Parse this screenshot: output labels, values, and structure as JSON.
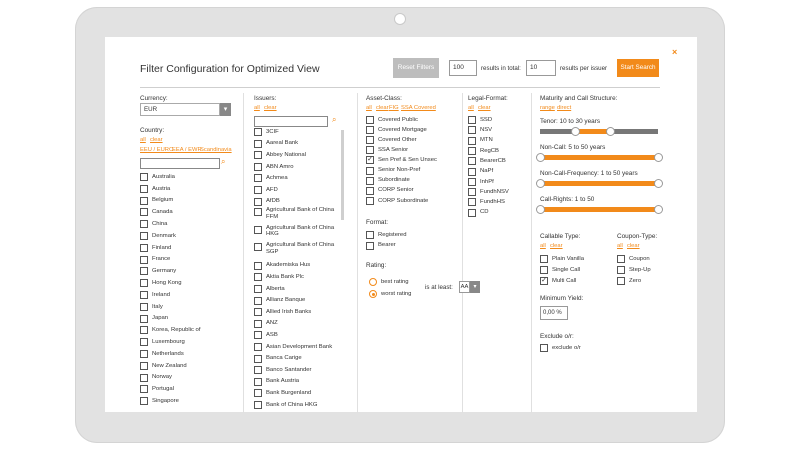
{
  "header": {
    "title": "Filter Configuration for Optimized View",
    "reset_label": "Reset Filters",
    "results_total_value": "100",
    "results_total_label": "results in total:",
    "results_per_issuer_value": "10",
    "results_per_issuer_label": "results per issuer",
    "search_label": "Start Search",
    "close_glyph": "×"
  },
  "currency": {
    "label": "Currency:",
    "value": "EUR"
  },
  "country": {
    "label": "Country:",
    "links": [
      "all",
      "clear"
    ],
    "regions": [
      "EEU / EURO",
      "EEA / EWR",
      "Scandinavia"
    ],
    "items": [
      "Australia",
      "Austria",
      "Belgium",
      "Canada",
      "China",
      "Denmark",
      "Finland",
      "France",
      "Germany",
      "Hong Kong",
      "Ireland",
      "Italy",
      "Japan",
      "Korea, Republic of",
      "Luxembourg",
      "Netherlands",
      "New Zealand",
      "Norway",
      "Portugal",
      "Singapore"
    ]
  },
  "issuers": {
    "label": "Issuers:",
    "links": [
      "all",
      "clear"
    ],
    "items": [
      "3CIF",
      "Aareal Bank",
      "Abbey National",
      "ABN Amro",
      "Achmea",
      "AFD",
      "AfDB",
      "Agricultural Bank of China FFM",
      "Agricultural Bank of China HKG",
      "Agricultural Bank of China SGP",
      "Akademiska Hus",
      "Aktia Bank Plc",
      "Alberta",
      "Allianz Banque",
      "Allied Irish Banks",
      "ANZ",
      "ASB",
      "Asian Development Bank",
      "Banca Carige",
      "Banco Santander",
      "Bank Austria",
      "Bank Burgenland",
      "Bank of China HKG"
    ]
  },
  "asset_class": {
    "label": "Asset-Class:",
    "links": [
      "all",
      "clear",
      "FIG",
      "SSA Covered"
    ],
    "items": [
      {
        "label": "Covered Public",
        "checked": false
      },
      {
        "label": "Covered Mortgage",
        "checked": false
      },
      {
        "label": "Covered Other",
        "checked": false
      },
      {
        "label": "SSA Senior",
        "checked": false
      },
      {
        "label": "Sen Pref & Sen Unsec",
        "checked": true
      },
      {
        "label": "Senior Non-Pref",
        "checked": false
      },
      {
        "label": "Subordinate",
        "checked": false
      },
      {
        "label": "CORP Senior",
        "checked": false
      },
      {
        "label": "CORP Subordinate",
        "checked": false
      }
    ]
  },
  "format": {
    "label": "Format:",
    "items": [
      "Registered",
      "Bearer"
    ]
  },
  "rating": {
    "label": "Rating:",
    "options": [
      {
        "label": "best rating",
        "selected": false
      },
      {
        "label": "worst rating",
        "selected": true
      }
    ],
    "at_least_label": "is at least:",
    "at_least_value": "AA"
  },
  "legal_format": {
    "label": "Legal-Format:",
    "links": [
      "all",
      "clear"
    ],
    "items": [
      "SSD",
      "NSV",
      "MTN",
      "RegCB",
      "BearerCB",
      "NaPf",
      "InhPf",
      "FundhNSV",
      "FundhHS",
      "CD"
    ]
  },
  "maturity": {
    "label": "Maturity and Call Structure:",
    "links": [
      "range",
      "direct"
    ],
    "sliders": [
      {
        "label": "Tenor: 10 to 30 years",
        "low": 0.3,
        "high": 0.6
      },
      {
        "label": "Non-Call: 5 to 50 years",
        "low": 0.0,
        "high": 1.0
      },
      {
        "label": "Non-Call-Frequency: 1 to 50 years",
        "low": 0.0,
        "high": 1.0
      },
      {
        "label": "Call-Rights: 1 to 50",
        "low": 0.0,
        "high": 1.0
      }
    ]
  },
  "callable": {
    "label": "Callable Type:",
    "links": [
      "all",
      "clear"
    ],
    "items": [
      {
        "label": "Plain Vanilla",
        "checked": false
      },
      {
        "label": "Single Call",
        "checked": false
      },
      {
        "label": "Multi Call",
        "checked": true
      }
    ]
  },
  "coupon": {
    "label": "Coupon-Type:",
    "links": [
      "all",
      "clear"
    ],
    "items": [
      "Coupon",
      "Step-Up",
      "Zero"
    ]
  },
  "min_yield": {
    "label": "Minimum Yield:",
    "value": "0,00 %"
  },
  "exclude": {
    "label": "Exclude o/r:",
    "item": "exclude o/r"
  },
  "colors": {
    "accent": "#f28a1a",
    "button_grey": "#bdbdbd",
    "track": "#777777"
  }
}
